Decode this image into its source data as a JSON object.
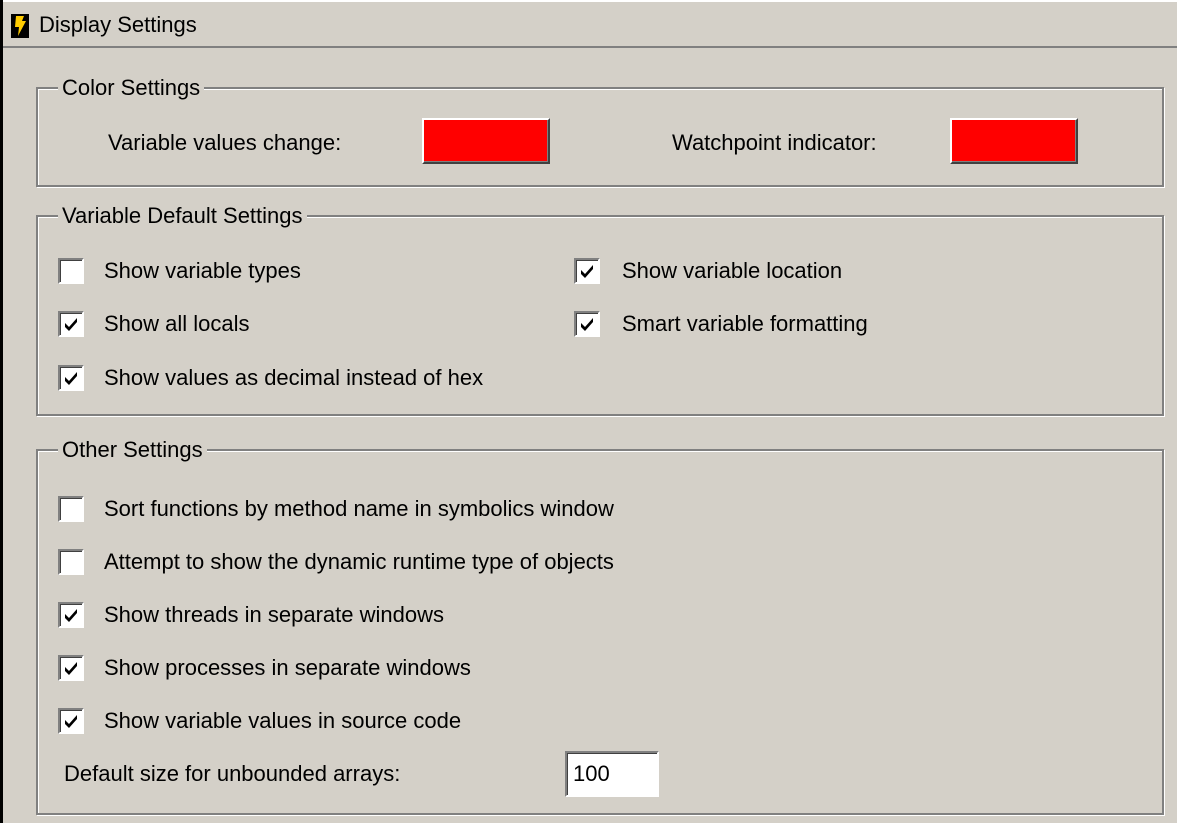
{
  "window": {
    "title": "Display Settings"
  },
  "color_settings": {
    "legend": "Color Settings",
    "variable_values_change_label": "Variable values change:",
    "variable_values_change_color": "#ff0000",
    "watchpoint_indicator_label": "Watchpoint indicator:",
    "watchpoint_indicator_color": "#ff0000"
  },
  "variable_defaults": {
    "legend": "Variable Default Settings",
    "show_variable_types": {
      "label": "Show variable types",
      "checked": false
    },
    "show_variable_location": {
      "label": "Show variable location",
      "checked": true
    },
    "show_all_locals": {
      "label": "Show all locals",
      "checked": true
    },
    "smart_variable_formatting": {
      "label": "Smart variable formatting",
      "checked": true
    },
    "show_values_decimal": {
      "label": "Show values as decimal instead of hex",
      "checked": true
    }
  },
  "other_settings": {
    "legend": "Other Settings",
    "sort_functions": {
      "label": "Sort functions by method name in symbolics window",
      "checked": false
    },
    "dynamic_runtime_type": {
      "label": "Attempt to show the dynamic runtime type of objects",
      "checked": false
    },
    "threads_separate": {
      "label": "Show threads in separate windows",
      "checked": true
    },
    "processes_separate": {
      "label": "Show processes in separate windows",
      "checked": true
    },
    "values_in_source": {
      "label": "Show variable values in source code",
      "checked": true
    },
    "array_size_label": "Default size for unbounded arrays:",
    "array_size_value": "100"
  },
  "colors": {
    "panel_bg": "#d4d0c8",
    "swatch_red": "#ff0000"
  }
}
